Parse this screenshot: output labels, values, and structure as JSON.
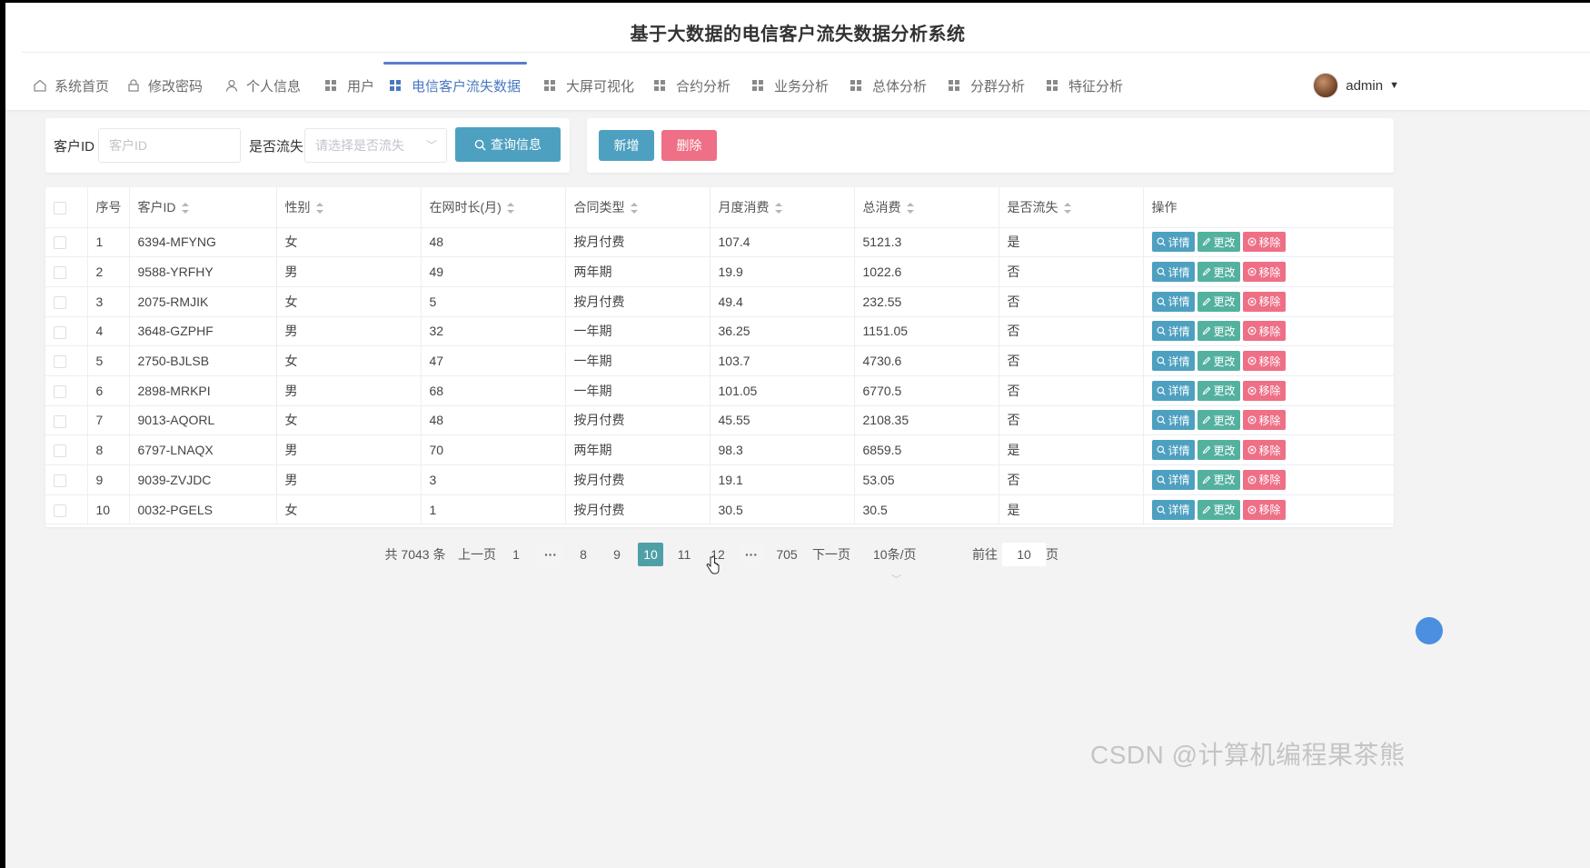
{
  "app": {
    "title": "基于大数据的电信客户流失数据分析系统"
  },
  "nav": {
    "items": [
      {
        "label": "系统首页",
        "icon": "home-icon"
      },
      {
        "label": "修改密码",
        "icon": "lock-icon"
      },
      {
        "label": "个人信息",
        "icon": "user-icon"
      },
      {
        "label": "用户",
        "icon": "grid-icon"
      },
      {
        "label": "电信客户流失数据",
        "icon": "grid-icon",
        "active": true
      },
      {
        "label": "大屏可视化",
        "icon": "grid-icon"
      },
      {
        "label": "合约分析",
        "icon": "grid-icon"
      },
      {
        "label": "业务分析",
        "icon": "grid-icon"
      },
      {
        "label": "总体分析",
        "icon": "grid-icon"
      },
      {
        "label": "分群分析",
        "icon": "grid-icon"
      },
      {
        "label": "特征分析",
        "icon": "grid-icon"
      }
    ],
    "user": "admin"
  },
  "search": {
    "customer_id_label": "客户ID",
    "customer_id_placeholder": "客户ID",
    "churn_label": "是否流失",
    "churn_placeholder": "请选择是否流失",
    "query_button": "查询信息"
  },
  "actions": {
    "add": "新增",
    "delete": "删除"
  },
  "table": {
    "columns": [
      "序号",
      "客户ID",
      "性别",
      "在网时长(月)",
      "合同类型",
      "月度消费",
      "总消费",
      "是否流失",
      "操作"
    ],
    "rows": [
      [
        "1",
        "6394-MFYNG",
        "女",
        "48",
        "按月付费",
        "107.4",
        "5121.3",
        "是"
      ],
      [
        "2",
        "9588-YRFHY",
        "男",
        "49",
        "两年期",
        "19.9",
        "1022.6",
        "否"
      ],
      [
        "3",
        "2075-RMJIK",
        "女",
        "5",
        "按月付费",
        "49.4",
        "232.55",
        "否"
      ],
      [
        "4",
        "3648-GZPHF",
        "男",
        "32",
        "一年期",
        "36.25",
        "1151.05",
        "否"
      ],
      [
        "5",
        "2750-BJLSB",
        "女",
        "47",
        "一年期",
        "103.7",
        "4730.6",
        "否"
      ],
      [
        "6",
        "2898-MRKPI",
        "男",
        "68",
        "一年期",
        "101.05",
        "6770.5",
        "否"
      ],
      [
        "7",
        "9013-AQORL",
        "女",
        "48",
        "按月付费",
        "45.55",
        "2108.35",
        "否"
      ],
      [
        "8",
        "6797-LNAQX",
        "男",
        "70",
        "两年期",
        "98.3",
        "6859.5",
        "是"
      ],
      [
        "9",
        "9039-ZVJDC",
        "男",
        "3",
        "按月付费",
        "19.1",
        "53.05",
        "否"
      ],
      [
        "10",
        "0032-PGELS",
        "女",
        "1",
        "按月付费",
        "30.5",
        "30.5",
        "是"
      ]
    ],
    "row_actions": {
      "detail": "详情",
      "edit": "更改",
      "remove": "移除"
    }
  },
  "pagination": {
    "total": "共 7043 条",
    "prev": "上一页",
    "pages": [
      "1",
      "8",
      "9",
      "10",
      "11",
      "12",
      "705"
    ],
    "current": "10",
    "next": "下一页",
    "page_size": "10条/页",
    "goto_label": "前往",
    "goto_value": "10",
    "goto_suffix": "页"
  },
  "watermark": "CSDN @计算机编程果茶熊",
  "colors": {
    "primary": "#4ea0c0",
    "danger": "#ee6f86",
    "edit": "#54b1a0",
    "nav_active": "#4a78c2"
  }
}
